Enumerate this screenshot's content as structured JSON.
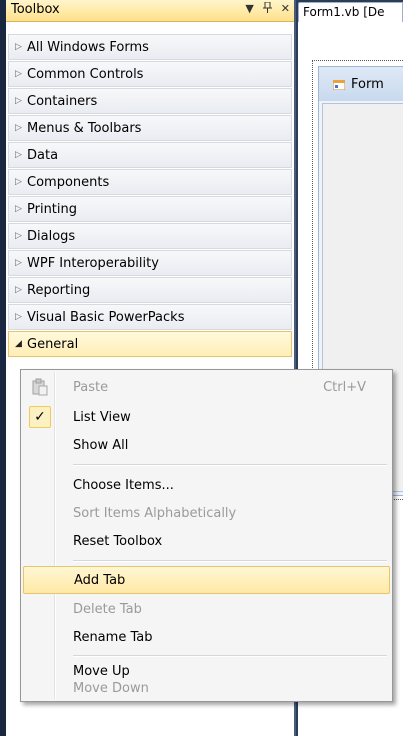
{
  "toolbox": {
    "title": "Toolbox",
    "dropdown_icon": "chevron-down-icon",
    "pin_icon": "pin-icon",
    "close_icon": "close-icon",
    "tabs": [
      {
        "label": "All Windows Forms",
        "expanded": false
      },
      {
        "label": "Common Controls",
        "expanded": false
      },
      {
        "label": "Containers",
        "expanded": false
      },
      {
        "label": "Menus & Toolbars",
        "expanded": false
      },
      {
        "label": "Data",
        "expanded": false
      },
      {
        "label": "Components",
        "expanded": false
      },
      {
        "label": "Printing",
        "expanded": false
      },
      {
        "label": "Dialogs",
        "expanded": false
      },
      {
        "label": "WPF Interoperability",
        "expanded": false
      },
      {
        "label": "Reporting",
        "expanded": false
      },
      {
        "label": "Visual Basic PowerPacks",
        "expanded": false
      },
      {
        "label": "General",
        "expanded": true
      }
    ]
  },
  "document_tab": {
    "label": "Form1.vb [De"
  },
  "designer": {
    "form_title": "Form"
  },
  "context_menu": {
    "items": [
      {
        "label": "Paste",
        "shortcut": "Ctrl+V",
        "enabled": false,
        "icon": "paste-icon"
      },
      {
        "label": "List View",
        "enabled": true,
        "checked": true
      },
      {
        "label": "Show All",
        "enabled": true
      },
      {
        "label": "Choose Items...",
        "enabled": true
      },
      {
        "label": "Sort Items Alphabetically",
        "enabled": false
      },
      {
        "label": "Reset Toolbox",
        "enabled": true
      },
      {
        "label": "Add Tab",
        "enabled": true,
        "hovered": true
      },
      {
        "label": "Delete Tab",
        "enabled": false
      },
      {
        "label": "Rename Tab",
        "enabled": true
      },
      {
        "label": "Move Up",
        "enabled": true
      },
      {
        "label": "Move Down",
        "enabled": false
      }
    ]
  },
  "colors": {
    "accent_highlight": "#ffe9a6",
    "ide_background": "#2b3c59"
  }
}
